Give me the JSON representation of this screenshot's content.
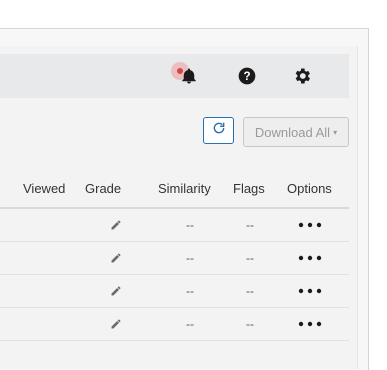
{
  "header": {
    "icons": [
      "bell-icon",
      "help-icon",
      "gear-icon"
    ],
    "notification_color": "#d64541"
  },
  "toolbar": {
    "refresh_icon": "refresh-icon",
    "download_label": "Download All",
    "download_caret": "▾",
    "accent": "#2a6fb0"
  },
  "table": {
    "columns": [
      "Viewed",
      "Grade",
      "Similarity",
      "Flags",
      "Options"
    ],
    "rows": [
      {
        "similarity": "--",
        "flags": "--"
      },
      {
        "similarity": "--",
        "flags": "--"
      },
      {
        "similarity": "--",
        "flags": "--"
      },
      {
        "similarity": "--",
        "flags": "--"
      }
    ]
  }
}
